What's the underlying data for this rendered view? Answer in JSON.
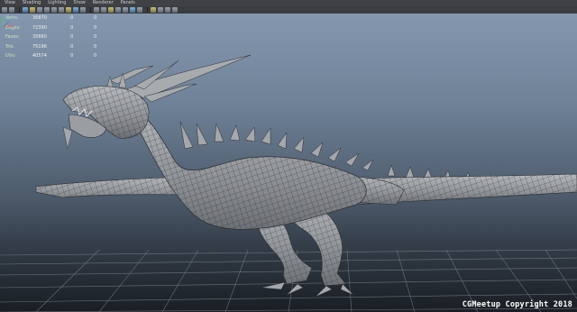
{
  "menu": [
    "View",
    "Shading",
    "Lighting",
    "Show",
    "Renderer",
    "Panels"
  ],
  "toolbar": {
    "icons": [
      "select-camera-icon",
      "camera-attributes-icon",
      "bookmark-icon",
      "image-plane-icon",
      "grid-icon",
      "film-gate-icon",
      "resolution-gate-icon",
      "gate-mask-icon",
      "field-chart-icon",
      "safe-action-icon",
      "safe-title-icon",
      "wireframe-icon",
      "smooth-shade-icon",
      "wireframe-on-shaded-icon",
      "textured-icon",
      "lights-icon",
      "shadows-icon",
      "xray-icon",
      "xray-joints-icon",
      "backface-culling-icon",
      "isolate-select-icon",
      "hud-icon"
    ]
  },
  "hud": [
    {
      "label": "Verts:",
      "value": "36870",
      "selected": "0",
      "triangles": "0"
    },
    {
      "label": "Edges:",
      "value": "72390",
      "selected": "0",
      "triangles": "0"
    },
    {
      "label": "Faces:",
      "value": "35660",
      "selected": "0",
      "triangles": "0"
    },
    {
      "label": "Tris:",
      "value": "75196",
      "selected": "0",
      "triangles": "0"
    },
    {
      "label": "UVs:",
      "value": "40574",
      "selected": "0",
      "triangles": "0"
    }
  ],
  "watermark": "CGMeetup Copyright 2018",
  "colors": {
    "hud_label": "#c7e5c3",
    "mesh_fill": "#9c9fa3",
    "mesh_wire": "#2a2c30",
    "grid": "#7f8a96"
  }
}
